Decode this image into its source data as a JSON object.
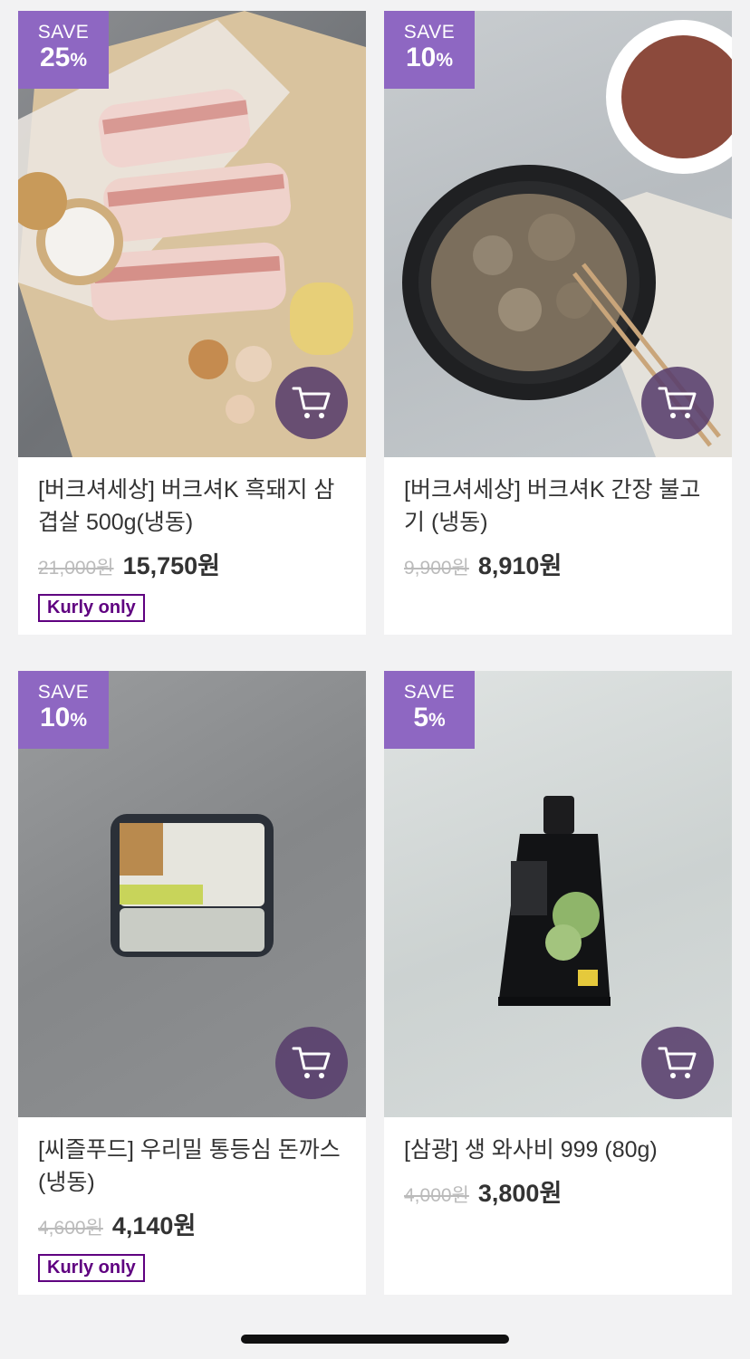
{
  "products": [
    {
      "save_label": "SAVE",
      "discount_rate": "25",
      "discount_unit": "%",
      "name": "[버크셔세상]  버크셔K 흑돼지 삼겹살 500g(냉동)",
      "original_price": "21,000원",
      "sale_price": "15,750원",
      "tag": "Kurly only",
      "image_icon": "pork-belly-image",
      "cart_icon": "cart-icon"
    },
    {
      "save_label": "SAVE",
      "discount_rate": "10",
      "discount_unit": "%",
      "name": "[버크셔세상] 버크셔K 간장 불고기 (냉동)",
      "original_price": "9,900원",
      "sale_price": "8,910원",
      "tag": "",
      "image_icon": "bulgogi-pan-image",
      "cart_icon": "cart-icon"
    },
    {
      "save_label": "SAVE",
      "discount_rate": "10",
      "discount_unit": "%",
      "name": "[씨즐푸드] 우리밀 통등심 돈까스 (냉동)",
      "original_price": "4,600원",
      "sale_price": "4,140원",
      "tag": "Kurly only",
      "image_icon": "cutlet-package-image",
      "cart_icon": "cart-icon"
    },
    {
      "save_label": "SAVE",
      "discount_rate": "5",
      "discount_unit": "%",
      "name": "[삼광] 생 와사비 999 (80g)",
      "original_price": "4,000원",
      "sale_price": "3,800원",
      "tag": "",
      "image_icon": "wasabi-pouch-image",
      "cart_icon": "cart-icon"
    }
  ],
  "colors": {
    "badge": "#8e67c2",
    "kurly_purple": "#5f0080",
    "cart_button": "#583e6c"
  }
}
